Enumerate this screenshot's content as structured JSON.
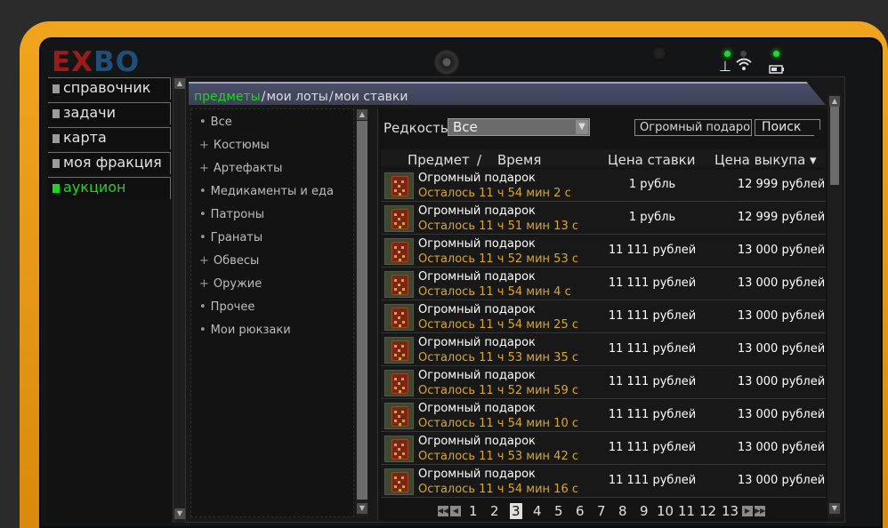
{
  "logo": {
    "part1": "EX",
    "part2": "BO"
  },
  "status": {
    "signal_icon": "radio-tower-icon",
    "wifi_icon": "wifi-icon",
    "battery_icon": "battery-icon"
  },
  "menu": [
    {
      "label": "справочник",
      "active": false
    },
    {
      "label": "задачи",
      "active": false
    },
    {
      "label": "карта",
      "active": false
    },
    {
      "label": "моя фракция",
      "active": false
    },
    {
      "label": "аукцион",
      "active": true
    }
  ],
  "tabs": [
    {
      "label": "предметы",
      "active": true
    },
    {
      "label": "мои лоты",
      "active": false
    },
    {
      "label": "мои ставки",
      "active": false
    }
  ],
  "tab_separator": "/",
  "categories": [
    {
      "marker": "•",
      "label": "Все"
    },
    {
      "marker": "+",
      "label": "Костюмы"
    },
    {
      "marker": "+",
      "label": "Артефакты"
    },
    {
      "marker": "•",
      "label": "Медикаменты и еда"
    },
    {
      "marker": "•",
      "label": "Патроны"
    },
    {
      "marker": "•",
      "label": "Гранаты"
    },
    {
      "marker": "+",
      "label": "Обвесы"
    },
    {
      "marker": "+",
      "label": "Оружие"
    },
    {
      "marker": "•",
      "label": "Прочее"
    },
    {
      "marker": "•",
      "label": "Мои рюкзаки"
    }
  ],
  "filter": {
    "rarity_label": "Редкость",
    "rarity_value": "Все",
    "search_value": "Огромный подарок",
    "search_button": "Поиск"
  },
  "columns": {
    "item": "Предмет",
    "sep": "/",
    "time": "Время",
    "bid": "Цена ставки",
    "buyout": "Цена выкупа ▾"
  },
  "lots": [
    {
      "name": "Огромный подарок",
      "time": "Осталось 11 ч 54 мин 2 с",
      "bid": "1 рубль",
      "buyout": "12 999 рублей"
    },
    {
      "name": "Огромный подарок",
      "time": "Осталось 11 ч 51 мин 13 с",
      "bid": "1 рубль",
      "buyout": "12 999 рублей"
    },
    {
      "name": "Огромный подарок",
      "time": "Осталось 11 ч 52 мин 53 с",
      "bid": "11 111 рублей",
      "buyout": "13 000 рублей"
    },
    {
      "name": "Огромный подарок",
      "time": "Осталось 11 ч 54 мин 4 с",
      "bid": "11 111 рублей",
      "buyout": "13 000 рублей"
    },
    {
      "name": "Огромный подарок",
      "time": "Осталось 11 ч 54 мин 25 с",
      "bid": "11 111 рублей",
      "buyout": "13 000 рублей"
    },
    {
      "name": "Огромный подарок",
      "time": "Осталось 11 ч 53 мин 35 с",
      "bid": "11 111 рублей",
      "buyout": "13 000 рублей"
    },
    {
      "name": "Огромный подарок",
      "time": "Осталось 11 ч 52 мин 59 с",
      "bid": "11 111 рублей",
      "buyout": "13 000 рублей"
    },
    {
      "name": "Огромный подарок",
      "time": "Осталось 11 ч 54 мин 10 с",
      "bid": "11 111 рублей",
      "buyout": "13 000 рублей"
    },
    {
      "name": "Огромный подарок",
      "time": "Осталось 11 ч 53 мин 42 с",
      "bid": "11 111 рублей",
      "buyout": "13 000 рублей"
    },
    {
      "name": "Огромный подарок",
      "time": "Осталось 11 ч 54 мин 16 с",
      "bid": "11 111 рублей",
      "buyout": "13 000 рублей"
    }
  ],
  "pager": {
    "pages": [
      "1",
      "2",
      "3",
      "4",
      "5",
      "6",
      "7",
      "8",
      "9",
      "10",
      "11",
      "12",
      "13"
    ],
    "current": "3"
  }
}
